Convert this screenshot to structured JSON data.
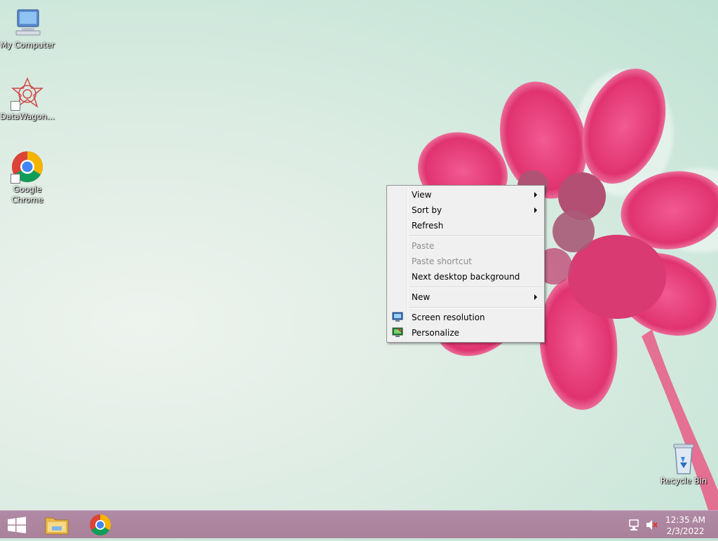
{
  "desktop": {
    "icons": [
      {
        "label": "My Computer"
      },
      {
        "label": "DataWagon..."
      },
      {
        "label": "Google Chrome"
      },
      {
        "label": "Recycle Bin"
      }
    ]
  },
  "context_menu": {
    "items": [
      {
        "label": "View",
        "submenu": true
      },
      {
        "label": "Sort by",
        "submenu": true
      },
      {
        "label": "Refresh"
      },
      {
        "label": "Paste",
        "disabled": true
      },
      {
        "label": "Paste shortcut",
        "disabled": true
      },
      {
        "label": "Next desktop background"
      },
      {
        "label": "New",
        "submenu": true
      },
      {
        "label": "Screen resolution",
        "icon": "screen-resolution-icon"
      },
      {
        "label": "Personalize",
        "icon": "personalize-icon"
      }
    ]
  },
  "taskbar": {
    "pinned": [
      {
        "icon": "start-windows-icon"
      },
      {
        "icon": "file-explorer-icon"
      },
      {
        "icon": "chrome-icon"
      }
    ],
    "tray": {
      "icons": [
        "network-icon",
        "volume-muted-icon"
      ],
      "time": "12:35 AM",
      "date": "2/3/2022"
    }
  },
  "colors": {
    "taskbar": "#a98199",
    "menu_bg": "#f0f0f0",
    "flower": "#e8407f"
  }
}
